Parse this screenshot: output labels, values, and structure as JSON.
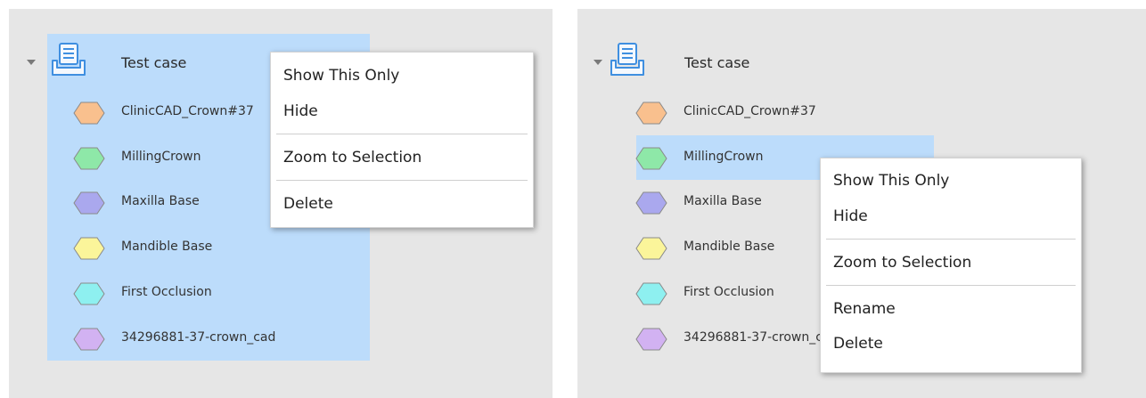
{
  "left_panel": {
    "root": {
      "label": "Test case"
    },
    "items": [
      {
        "label": "ClinicCAD_Crown#37",
        "color": "#f9c08e"
      },
      {
        "label": "MillingCrown",
        "color": "#8ee8a8"
      },
      {
        "label": "Maxilla Base",
        "color": "#aaa8ee"
      },
      {
        "label": "Mandible Base",
        "color": "#fbf59a"
      },
      {
        "label": "First Occlusion",
        "color": "#8ef0f0"
      },
      {
        "label": "34296881-37-crown_cad",
        "color": "#d2b2f2"
      }
    ],
    "context_menu": {
      "items": [
        "Show This Only",
        "Hide",
        "Zoom to Selection",
        "Delete"
      ]
    }
  },
  "right_panel": {
    "root": {
      "label": "Test case"
    },
    "items": [
      {
        "label": "ClinicCAD_Crown#37",
        "color": "#f9c08e"
      },
      {
        "label": "MillingCrown",
        "color": "#8ee8a8"
      },
      {
        "label": "Maxilla Base",
        "color": "#aaa8ee"
      },
      {
        "label": "Mandible Base",
        "color": "#fbf59a"
      },
      {
        "label": "First Occlusion",
        "color": "#8ef0f0"
      },
      {
        "label": "34296881-37-crown_cad",
        "color": "#d2b2f2"
      }
    ],
    "context_menu": {
      "items": [
        "Show This Only",
        "Hide",
        "Zoom to Selection",
        "Rename",
        "Delete"
      ]
    }
  },
  "colors": {
    "selection": "#bcdcfb",
    "panel": "#e6e6e6"
  }
}
